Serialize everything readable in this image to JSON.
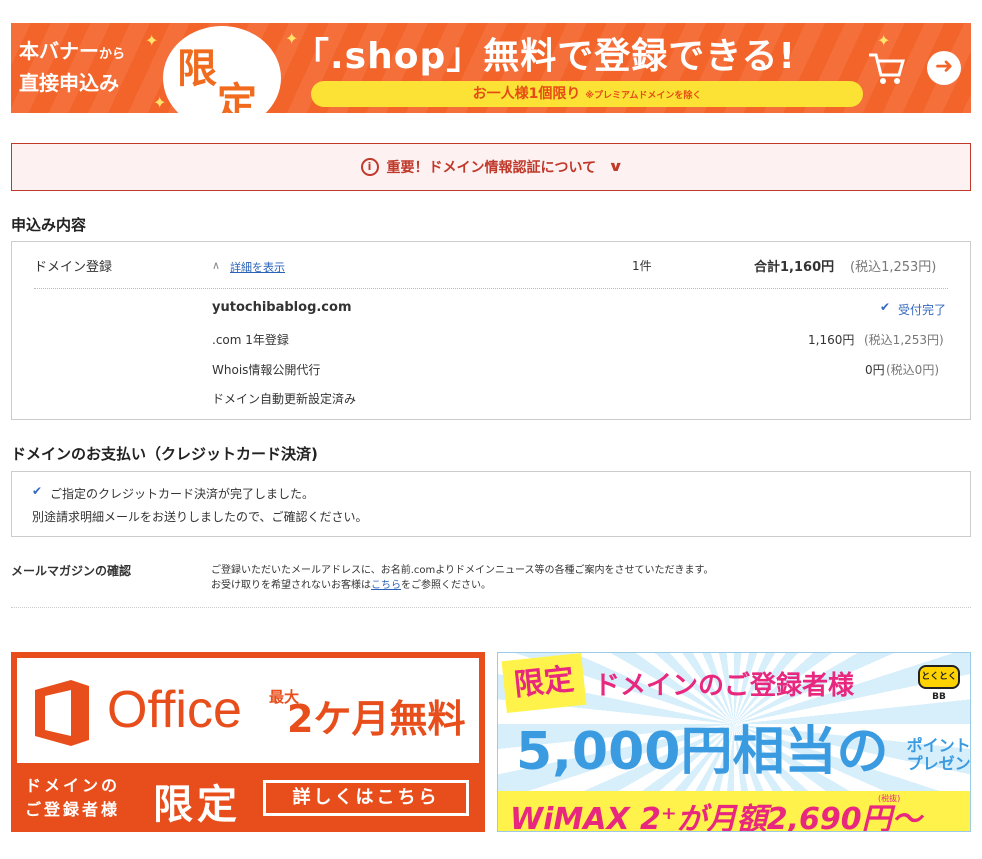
{
  "top_banner": {
    "left_line1": "本バナー",
    "left_line1_small": "から",
    "left_line2": "直接申込み",
    "circle_char1": "限",
    "circle_char2": "定",
    "headline": "「.shop」無料で登録できる!",
    "pill_text": "お一人様1個限り",
    "pill_note": "※プレミアムドメインを除く",
    "cart_icon": "cart-icon",
    "arrow_icon": "arrow-right-icon",
    "colors": {
      "bg": "#f3642a",
      "pill": "#fbe234"
    }
  },
  "notice": {
    "icon": "info-icon",
    "text": "重要！ドメイン情報認証について",
    "chevron": "chevron-down-icon"
  },
  "order": {
    "section_title": "申込み内容",
    "item_label": "ドメイン登録",
    "detail_link": "詳細を表示",
    "count": "1件",
    "total_label": "合計1,160円",
    "total_tax": "(税込1,253円)",
    "domain": "yutochibablog.com",
    "status": "受付完了",
    "lines": [
      {
        "label": ".com 1年登録",
        "price": "1,160円",
        "tax": "(税込1,253円)"
      },
      {
        "label": "Whois情報公開代行",
        "price": "0円",
        "tax": "(税込0円)"
      },
      {
        "label": "ドメイン自動更新設定済み",
        "price": "",
        "tax": ""
      }
    ]
  },
  "payment": {
    "section_title": "ドメインのお支払い（クレジットカード決済)",
    "complete_text": "ご指定のクレジットカード決済が完了しました。",
    "mail_text": "別途請求明細メールをお送りしましたので、ご確認ください。"
  },
  "mail_magazine": {
    "label": "メールマガジンの確認",
    "line1": "ご登録いただいたメールアドレスに、お名前.comよりドメインニュース等の各種ご案内をさせていただきます。",
    "line2_before": "お受け取りを希望されないお客様は",
    "line2_link": "こちら",
    "line2_after": "をご参照ください。"
  },
  "office_banner": {
    "logo_icon": "office-logo-icon",
    "name": "Office",
    "free_small": "最大",
    "free_big": "2ケ月無料",
    "bottom_line1": "ドメインの",
    "bottom_line2": "ご登録者様",
    "gentei": "限定",
    "button": "詳しくはこちら",
    "colors": {
      "bg": "#e84e1b"
    }
  },
  "wimax_banner": {
    "gentei": "限定",
    "top": "ドメインのご登録者様",
    "badge": "とくとくBB",
    "amount": "5,000円相当の",
    "point": "ポイント",
    "present": "プレゼント",
    "bottom": "WiMAX 2⁺が月額2,690円～",
    "tax": "(税抜)",
    "colors": {
      "pink": "#e8287f",
      "blue": "#3a9be0",
      "yellow": "#fff34b"
    }
  }
}
